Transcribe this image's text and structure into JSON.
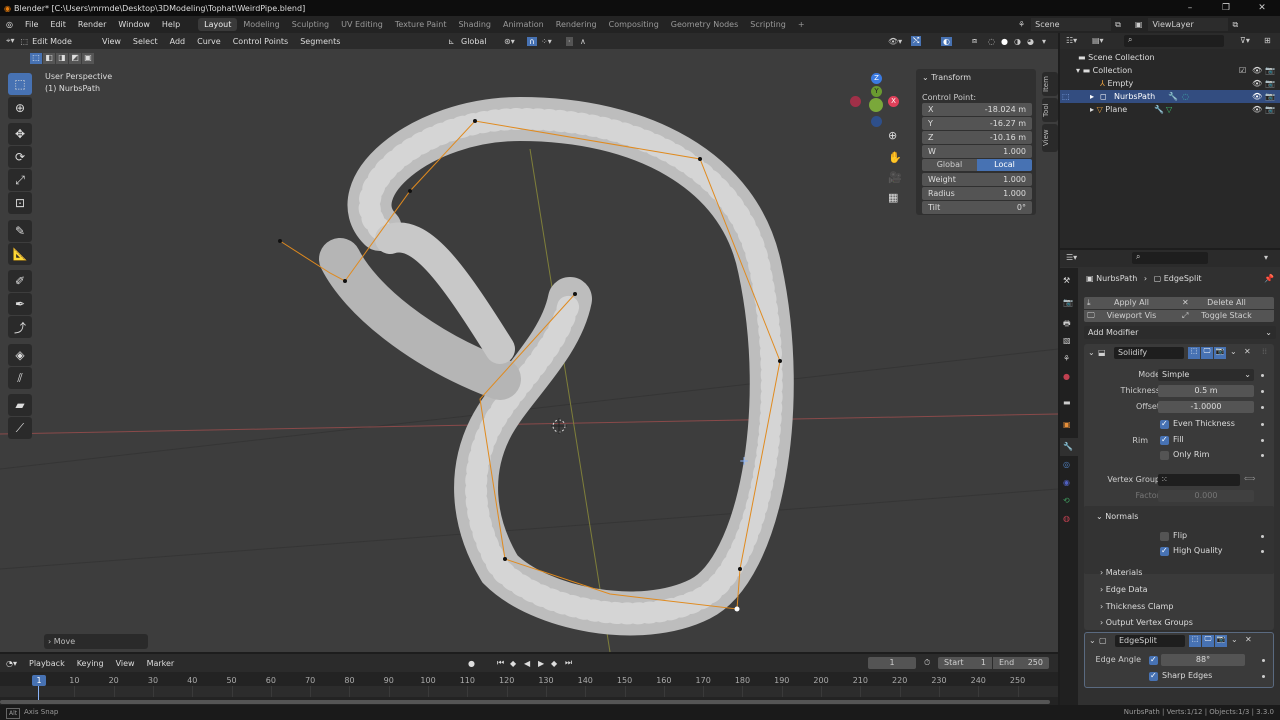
{
  "title": "Blender* [C:\\Users\\mrmde\\Desktop\\3DModeling\\Tophat\\WeirdPipe.blend]",
  "window_controls": [
    "–",
    "❐",
    "✕"
  ],
  "menu": [
    "File",
    "Edit",
    "Render",
    "Window",
    "Help"
  ],
  "workspaces": [
    "Layout",
    "Modeling",
    "Sculpting",
    "UV Editing",
    "Texture Paint",
    "Shading",
    "Animation",
    "Rendering",
    "Compositing",
    "Geometry Nodes",
    "Scripting",
    "+"
  ],
  "active_workspace": "Layout",
  "scene": {
    "label": "Scene",
    "view_layer": "ViewLayer"
  },
  "viewport_header": {
    "mode": "Edit Mode",
    "menus": [
      "View",
      "Select",
      "Add",
      "Curve",
      "Control Points",
      "Segments"
    ],
    "orientation": "Global"
  },
  "viewport": {
    "perspective": "User Perspective",
    "object": "(1) NurbsPath",
    "last_op": "Move"
  },
  "gizmo": {
    "z": "Z",
    "y": "Y",
    "x": "X"
  },
  "side_tabs": [
    "Item",
    "Tool",
    "View"
  ],
  "transform": {
    "title": "Transform",
    "section": "Control Point:",
    "x": {
      "label": "X",
      "value": "-18.024 m"
    },
    "y": {
      "label": "Y",
      "value": "-16.27 m"
    },
    "z": {
      "label": "Z",
      "value": "-10.16 m"
    },
    "w": {
      "label": "W",
      "value": "1.000"
    },
    "global": "Global",
    "local": "Local",
    "weight": {
      "label": "Weight",
      "value": "1.000"
    },
    "radius": {
      "label": "Radius",
      "value": "1.000"
    },
    "tilt": {
      "label": "Tilt",
      "value": "0°"
    }
  },
  "outliner": {
    "root": "Scene Collection",
    "collection": "Collection",
    "items": [
      {
        "name": "Empty",
        "selected": false
      },
      {
        "name": "NurbsPath",
        "selected": true
      },
      {
        "name": "Plane",
        "selected": false
      }
    ]
  },
  "properties": {
    "breadcrumb_object": "NurbsPath",
    "breadcrumb_modifier": "EdgeSplit",
    "apply_all": "Apply All",
    "delete_all": "Delete All",
    "viewport_vis": "Viewport Vis",
    "toggle_stack": "Toggle Stack",
    "add_modifier": "Add Modifier",
    "solidify": {
      "name": "Solidify",
      "mode_label": "Mode",
      "mode": "Simple",
      "thickness_label": "Thickness",
      "thickness": "0.5 m",
      "offset_label": "Offset",
      "offset": "-1.0000",
      "even_thickness": "Even Thickness",
      "rim_label": "Rim",
      "fill": "Fill",
      "only_rim": "Only Rim",
      "vertex_group_label": "Vertex Group",
      "factor_label": "Factor",
      "factor": "0.000",
      "normals": "Normals",
      "flip": "Flip",
      "high_quality": "High Quality",
      "subpanels": [
        "Materials",
        "Edge Data",
        "Thickness Clamp",
        "Output Vertex Groups"
      ]
    },
    "edgesplit": {
      "name": "EdgeSplit",
      "edge_angle_label": "Edge Angle",
      "edge_angle": "88°",
      "sharp_edges": "Sharp Edges"
    }
  },
  "timeline": {
    "menus": [
      "Playback",
      "Keying",
      "View",
      "Marker"
    ],
    "current_frame": "1",
    "start_label": "Start",
    "start": "1",
    "end_label": "End",
    "end": "250",
    "ticks": [
      "10",
      "20",
      "30",
      "40",
      "50",
      "60",
      "70",
      "80",
      "90",
      "100",
      "110",
      "120",
      "130",
      "140",
      "150",
      "160",
      "170",
      "180",
      "190",
      "200",
      "210",
      "220",
      "230",
      "240",
      "250"
    ]
  },
  "status": {
    "left": "Axis Snap",
    "right": "NurbsPath | Verts:1/12 | Objects:1/3 | 3.3.0"
  }
}
